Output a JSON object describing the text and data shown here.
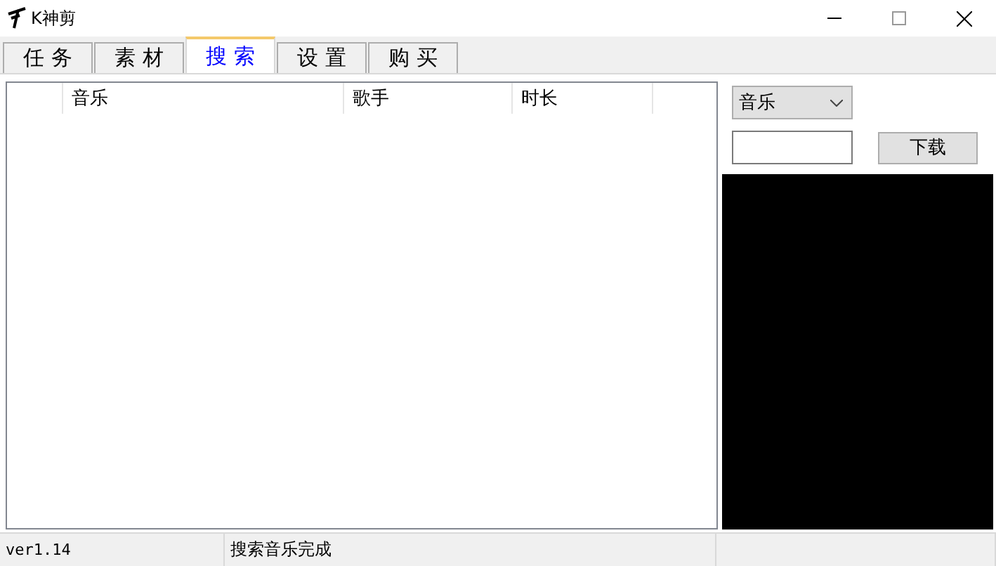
{
  "window": {
    "title": "K神剪"
  },
  "tabs": [
    {
      "label": "任 务",
      "selected": false
    },
    {
      "label": "素 材",
      "selected": false
    },
    {
      "label": "搜 索",
      "selected": true
    },
    {
      "label": "设 置",
      "selected": false
    },
    {
      "label": "购 买",
      "selected": false
    }
  ],
  "table": {
    "columns": [
      null,
      "音乐",
      "歌手",
      "时长"
    ]
  },
  "side_panel": {
    "category": "音乐",
    "download_button": "下载",
    "preview": {
      "kind": "blank"
    }
  },
  "status_bar": [
    "ver1.14",
    "搜索音乐完成"
  ]
}
